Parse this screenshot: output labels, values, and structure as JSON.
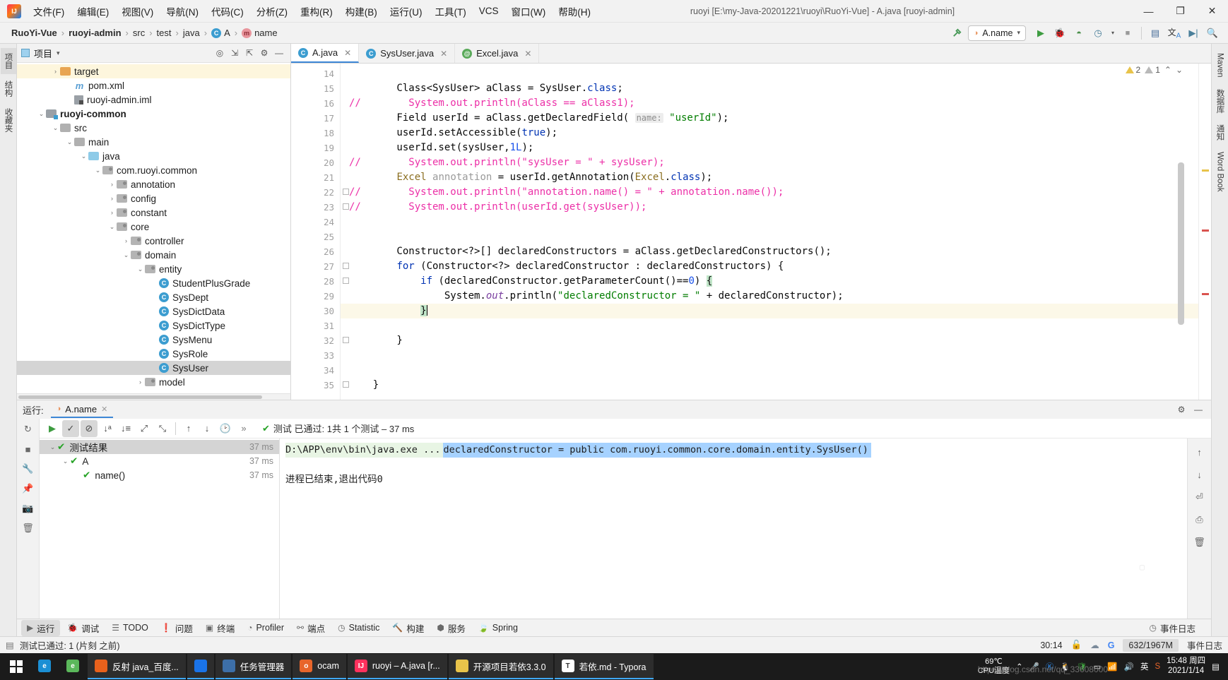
{
  "window": {
    "title": "ruoyi [E:\\my-Java-20201221\\ruoyi\\RuoYi-Vue] - A.java [ruoyi-admin]",
    "minimize": "—",
    "maximize": "❐",
    "close": "✕"
  },
  "menu": [
    {
      "label": "文件(F)",
      "name": "menu-file"
    },
    {
      "label": "编辑(E)",
      "name": "menu-edit"
    },
    {
      "label": "视图(V)",
      "name": "menu-view"
    },
    {
      "label": "导航(N)",
      "name": "menu-navigate"
    },
    {
      "label": "代码(C)",
      "name": "menu-code"
    },
    {
      "label": "分析(Z)",
      "name": "menu-analyze"
    },
    {
      "label": "重构(R)",
      "name": "menu-refactor"
    },
    {
      "label": "构建(B)",
      "name": "menu-build"
    },
    {
      "label": "运行(U)",
      "name": "menu-run"
    },
    {
      "label": "工具(T)",
      "name": "menu-tools"
    },
    {
      "label": "VCS",
      "name": "menu-vcs"
    },
    {
      "label": "窗口(W)",
      "name": "menu-window"
    },
    {
      "label": "帮助(H)",
      "name": "menu-help"
    }
  ],
  "breadcrumb": [
    {
      "label": "RuoYi-Vue",
      "bold": true,
      "icon": ""
    },
    {
      "label": "ruoyi-admin",
      "bold": true,
      "icon": ""
    },
    {
      "label": "src",
      "bold": false,
      "icon": ""
    },
    {
      "label": "test",
      "bold": false,
      "icon": ""
    },
    {
      "label": "java",
      "bold": false,
      "icon": ""
    },
    {
      "label": "A",
      "bold": false,
      "icon": "class-icon"
    },
    {
      "label": "name",
      "bold": false,
      "icon": "method-icon"
    }
  ],
  "toolbar": {
    "build_icon": "hammer-icon",
    "run_config": "A.name",
    "run": "▶",
    "debug": "debug-icon",
    "run_coverage": "coverage-icon",
    "profile": "profile-icon",
    "stop": "■",
    "build_project": "build-project-icon",
    "translate": "translate-icon",
    "terminal": "terminal-icon",
    "search": "search-icon"
  },
  "left_strip_tabs": [
    {
      "label": "项目",
      "name": "tool-window-project",
      "active": true
    },
    {
      "label": "结构",
      "name": "tool-window-structure",
      "active": false
    },
    {
      "label": "收藏夹",
      "name": "tool-window-favorites",
      "active": false
    }
  ],
  "right_strip_tabs": [
    {
      "label": "Maven",
      "name": "tool-window-maven"
    },
    {
      "label": "数据库",
      "name": "tool-window-database"
    },
    {
      "label": "通知",
      "name": "tool-window-notifications"
    },
    {
      "label": "Word Book",
      "name": "tool-window-word-book"
    }
  ],
  "project_panel": {
    "title": "项目",
    "dropdown": "▾",
    "icons": [
      "locate-icon",
      "expand-all-icon",
      "collapse-all-icon",
      "settings-icon",
      "hide-icon"
    ],
    "tree": [
      {
        "label": "target",
        "indent": 3,
        "arrow": "›",
        "icon": "folder-orange",
        "bold": false,
        "highlight": true
      },
      {
        "label": "pom.xml",
        "indent": 4,
        "arrow": "",
        "icon": "maven-m",
        "bold": false
      },
      {
        "label": "ruoyi-admin.iml",
        "indent": 4,
        "arrow": "",
        "icon": "iml",
        "bold": false
      },
      {
        "label": "ruoyi-common",
        "indent": 2,
        "arrow": "⌄",
        "icon": "folder-module",
        "bold": true
      },
      {
        "label": "src",
        "indent": 3,
        "arrow": "⌄",
        "icon": "folder-gray",
        "bold": false
      },
      {
        "label": "main",
        "indent": 4,
        "arrow": "⌄",
        "icon": "folder-gray",
        "bold": false
      },
      {
        "label": "java",
        "indent": 5,
        "arrow": "⌄",
        "icon": "folder-blue",
        "bold": false
      },
      {
        "label": "com.ruoyi.common",
        "indent": 6,
        "arrow": "⌄",
        "icon": "folder-pkg",
        "bold": false
      },
      {
        "label": "annotation",
        "indent": 7,
        "arrow": "›",
        "icon": "folder-pkg",
        "bold": false
      },
      {
        "label": "config",
        "indent": 7,
        "arrow": "›",
        "icon": "folder-pkg",
        "bold": false
      },
      {
        "label": "constant",
        "indent": 7,
        "arrow": "›",
        "icon": "folder-pkg",
        "bold": false
      },
      {
        "label": "core",
        "indent": 7,
        "arrow": "⌄",
        "icon": "folder-pkg",
        "bold": false
      },
      {
        "label": "controller",
        "indent": 8,
        "arrow": "›",
        "icon": "folder-pkg",
        "bold": false
      },
      {
        "label": "domain",
        "indent": 8,
        "arrow": "⌄",
        "icon": "folder-pkg",
        "bold": false
      },
      {
        "label": "entity",
        "indent": 9,
        "arrow": "⌄",
        "icon": "folder-pkg",
        "bold": false
      },
      {
        "label": "StudentPlusGrade",
        "indent": 10,
        "arrow": "",
        "icon": "class-c",
        "bold": false
      },
      {
        "label": "SysDept",
        "indent": 10,
        "arrow": "",
        "icon": "class-c",
        "bold": false
      },
      {
        "label": "SysDictData",
        "indent": 10,
        "arrow": "",
        "icon": "class-c",
        "bold": false
      },
      {
        "label": "SysDictType",
        "indent": 10,
        "arrow": "",
        "icon": "class-c",
        "bold": false
      },
      {
        "label": "SysMenu",
        "indent": 10,
        "arrow": "",
        "icon": "class-c",
        "bold": false
      },
      {
        "label": "SysRole",
        "indent": 10,
        "arrow": "",
        "icon": "class-c",
        "bold": false
      },
      {
        "label": "SysUser",
        "indent": 10,
        "arrow": "",
        "icon": "class-c",
        "bold": false,
        "selected": true
      },
      {
        "label": "model",
        "indent": 9,
        "arrow": "›",
        "icon": "folder-pkg",
        "bold": false
      }
    ]
  },
  "editor": {
    "tabs": [
      {
        "label": "A.java",
        "icon": "class-c",
        "active": true,
        "close": "✕"
      },
      {
        "label": "SysUser.java",
        "icon": "class-c",
        "active": false,
        "close": "✕"
      },
      {
        "label": "Excel.java",
        "icon": "annotation-a",
        "active": false,
        "close": "✕"
      }
    ],
    "inspections": {
      "warning_count": "2",
      "weak_count": "1",
      "warning_icon": "warning-triangle-icon",
      "up": "⌃",
      "down": "⌄"
    },
    "first_line": 14,
    "lines": [
      {
        "n": 14,
        "fold": "",
        "segs": []
      },
      {
        "n": 15,
        "fold": "",
        "segs": [
          {
            "t": "        Class<SysUser> aClass = SysUser.",
            "c": ""
          },
          {
            "t": "class",
            "c": "kw"
          },
          {
            "t": ";",
            "c": ""
          }
        ]
      },
      {
        "n": 16,
        "fold": "",
        "segs": [
          {
            "t": "//        System.out.println(aClass == aClass1);",
            "c": "cmt",
            "indent": "comment"
          }
        ]
      },
      {
        "n": 17,
        "fold": "",
        "segs": [
          {
            "t": "        Field userId = aClass.getDeclaredField( ",
            "c": ""
          },
          {
            "t": "name:",
            "c": "hint"
          },
          {
            "t": " ",
            "c": ""
          },
          {
            "t": "\"userId\"",
            "c": "str"
          },
          {
            "t": ");",
            "c": ""
          }
        ]
      },
      {
        "n": 18,
        "fold": "",
        "segs": [
          {
            "t": "        userId.setAccessible(",
            "c": ""
          },
          {
            "t": "true",
            "c": "kw"
          },
          {
            "t": ");",
            "c": ""
          }
        ]
      },
      {
        "n": 19,
        "fold": "",
        "segs": [
          {
            "t": "        userId.set(sysUser,",
            "c": ""
          },
          {
            "t": "1L",
            "c": "num"
          },
          {
            "t": ");",
            "c": ""
          }
        ]
      },
      {
        "n": 20,
        "fold": "",
        "segs": [
          {
            "t": "//        System.out.println(\"sysUser = \" + sysUser);",
            "c": "cmt",
            "indent": "comment"
          }
        ]
      },
      {
        "n": 21,
        "fold": "",
        "segs": [
          {
            "t": "        ",
            "c": ""
          },
          {
            "t": "Excel",
            "c": "typ"
          },
          {
            "t": " ",
            "c": ""
          },
          {
            "t": "annotation",
            "c": "grey"
          },
          {
            "t": " = userId.getAnnotation(",
            "c": ""
          },
          {
            "t": "Excel",
            "c": "typ"
          },
          {
            "t": ".",
            "c": ""
          },
          {
            "t": "class",
            "c": "kw"
          },
          {
            "t": ");",
            "c": ""
          }
        ]
      },
      {
        "n": 22,
        "fold": "⌄",
        "segs": [
          {
            "t": "//        System.out.println(\"annotation.name() = \" + annotation.name());",
            "c": "cmt",
            "indent": "comment"
          }
        ]
      },
      {
        "n": 23,
        "fold": "⌃",
        "segs": [
          {
            "t": "//        System.out.println(userId.get(sysUser));",
            "c": "cmt",
            "indent": "comment"
          }
        ]
      },
      {
        "n": 24,
        "fold": "",
        "segs": []
      },
      {
        "n": 25,
        "fold": "",
        "segs": []
      },
      {
        "n": 26,
        "fold": "",
        "segs": [
          {
            "t": "        Constructor<?>[] declaredConstructors = aClass.getDeclaredConstructors();",
            "c": ""
          }
        ]
      },
      {
        "n": 27,
        "fold": "⌄",
        "segs": [
          {
            "t": "        ",
            "c": ""
          },
          {
            "t": "for",
            "c": "kw"
          },
          {
            "t": " (Constructor<?> declaredConstructor : declaredConstructors) {",
            "c": ""
          }
        ]
      },
      {
        "n": 28,
        "fold": "⌄",
        "segs": [
          {
            "t": "            ",
            "c": ""
          },
          {
            "t": "if",
            "c": "kw"
          },
          {
            "t": " (declaredConstructor.getParameterCount()==",
            "c": ""
          },
          {
            "t": "0",
            "c": "num"
          },
          {
            "t": ") ",
            "c": ""
          },
          {
            "t": "{",
            "c": "brace"
          }
        ]
      },
      {
        "n": 29,
        "fold": "",
        "segs": [
          {
            "t": "                System.",
            "c": ""
          },
          {
            "t": "out",
            "c": "fld"
          },
          {
            "t": ".println(",
            "c": ""
          },
          {
            "t": "\"declaredConstructor = \"",
            "c": "str"
          },
          {
            "t": " + declaredConstructor);",
            "c": ""
          }
        ]
      },
      {
        "n": 30,
        "fold": "⌃",
        "highlight": true,
        "caret": true,
        "segs": [
          {
            "t": "            ",
            "c": ""
          },
          {
            "t": "}",
            "c": "brace"
          }
        ]
      },
      {
        "n": 31,
        "fold": "",
        "segs": []
      },
      {
        "n": 32,
        "fold": "⌃",
        "segs": [
          {
            "t": "        }",
            "c": ""
          }
        ]
      },
      {
        "n": 33,
        "fold": "",
        "segs": []
      },
      {
        "n": 34,
        "fold": "",
        "segs": []
      },
      {
        "n": 35,
        "fold": "⌃",
        "segs": [
          {
            "t": "    }",
            "c": ""
          }
        ]
      }
    ]
  },
  "run_panel": {
    "label": "运行:",
    "tab": "A.name",
    "tab_close": "✕",
    "settings_icon": "gear-icon",
    "hide_icon": "minimize-icon",
    "toolbar_icons": [
      "rerun-icon",
      "show-passed-icon",
      "hide-ignored-icon",
      "sort-alpha-icon",
      "sort-duration-icon",
      "expand-all-icon",
      "collapse-all-icon",
      "prev-icon",
      "next-icon",
      "history-icon",
      "more-icon"
    ],
    "status_text": "测试 已通过: 1共 1 个测试 – 37 ms",
    "status_check": "✔",
    "more": "»",
    "tests": [
      {
        "label": "测试结果",
        "duration": "37 ms",
        "indent": 0,
        "arrow": "⌄",
        "state": "passed",
        "selected": true
      },
      {
        "label": "A",
        "duration": "37 ms",
        "indent": 1,
        "arrow": "⌄",
        "state": "passed",
        "selected": false
      },
      {
        "label": "name()",
        "duration": "37 ms",
        "indent": 2,
        "arrow": "",
        "state": "passed",
        "selected": false
      }
    ],
    "console": [
      {
        "text": "D:\\APP\\env\\bin\\java.exe ...",
        "style": "green"
      },
      {
        "text": "declaredConstructor = public com.ruoyi.common.core.domain.entity.SysUser()",
        "style": "selected"
      },
      {
        "text": "",
        "style": ""
      },
      {
        "text": "进程已结束,退出代码0",
        "style": "plain"
      }
    ],
    "console_right_icons": [
      "scroll-up-icon",
      "scroll-down-icon",
      "soft-wrap-icon",
      "print-icon",
      "clear-icon"
    ]
  },
  "bottom_tools": [
    {
      "label": "运行",
      "icon": "▶",
      "name": "bottom-tab-run",
      "active": true
    },
    {
      "label": "调试",
      "icon": "debug-icon",
      "name": "bottom-tab-debug",
      "active": false
    },
    {
      "label": "TODO",
      "icon": "list-icon",
      "name": "bottom-tab-todo",
      "active": false
    },
    {
      "label": "问题",
      "icon": "problems-icon",
      "name": "bottom-tab-problems",
      "active": false
    },
    {
      "label": "终端",
      "icon": "terminal-icon",
      "name": "bottom-tab-terminal",
      "active": false
    },
    {
      "label": "Profiler",
      "icon": "profiler-icon",
      "name": "bottom-tab-profiler",
      "active": false
    },
    {
      "label": "端点",
      "icon": "endpoints-icon",
      "name": "bottom-tab-endpoints",
      "active": false
    },
    {
      "label": "Statistic",
      "icon": "statistic-icon",
      "name": "bottom-tab-statistic",
      "active": false
    },
    {
      "label": "构建",
      "icon": "hammer-icon",
      "name": "bottom-tab-build",
      "active": false
    },
    {
      "label": "服务",
      "icon": "services-icon",
      "name": "bottom-tab-services",
      "active": false
    },
    {
      "label": "Spring",
      "icon": "spring-leaf-icon",
      "name": "bottom-tab-spring",
      "active": false
    }
  ],
  "event_log": {
    "label": "事件日志",
    "icon": "event-log-icon"
  },
  "statusbar": {
    "message": "测试已通过: 1 (片刻 之前)",
    "message_icon": "document-icon",
    "caret": "30:14",
    "lock_icon": "lock-icon",
    "cloud_icon": "cloud-icon",
    "google_icon": "google-icon",
    "memory": "632/1967M"
  },
  "taskbar": {
    "start": "start-icon",
    "items": [
      {
        "label": "",
        "icon": "edge-icon",
        "name": "taskbar-edge",
        "color": "#1b8fd4",
        "glyph": "e",
        "open": false
      },
      {
        "label": "",
        "icon": "ie-icon",
        "name": "taskbar-ie",
        "color": "#5bb85b",
        "glyph": "e",
        "open": false
      },
      {
        "label": "反射 java_百度...",
        "icon": "firefox-icon",
        "name": "taskbar-firefox",
        "color": "#e8611c",
        "glyph": "",
        "open": true
      },
      {
        "label": "",
        "icon": "chrome-icon",
        "name": "taskbar-chrome",
        "color": "#1a73e8",
        "glyph": "",
        "open": true
      },
      {
        "label": "任务管理器",
        "icon": "task-manager-icon",
        "name": "taskbar-task-manager",
        "color": "#3d6fa8",
        "glyph": "",
        "open": true
      },
      {
        "label": "ocam",
        "icon": "ocam-icon",
        "name": "taskbar-ocam",
        "color": "#e8652a",
        "glyph": "o",
        "open": true
      },
      {
        "label": "ruoyi – A.java [r...",
        "icon": "intellij-icon",
        "name": "taskbar-intellij",
        "color": "#fe315d",
        "glyph": "IJ",
        "open": true,
        "active": true
      },
      {
        "label": "开源项目若依3.3.0",
        "icon": "folder-icon",
        "name": "taskbar-folder",
        "color": "#e8c34a",
        "glyph": "",
        "open": true
      },
      {
        "label": "若依.md - Typora",
        "icon": "typora-icon",
        "name": "taskbar-typora",
        "color": "#ffffff",
        "glyph": "T",
        "open": true
      }
    ],
    "cpu_temp_value": "69℃",
    "cpu_temp_label": "CPU温度",
    "tray_chevron": "⌃",
    "clock_time": "15:48 周四",
    "clock_date": "2021/1/14",
    "watermark": "https://blog.csdn.net/qq_33608000"
  }
}
